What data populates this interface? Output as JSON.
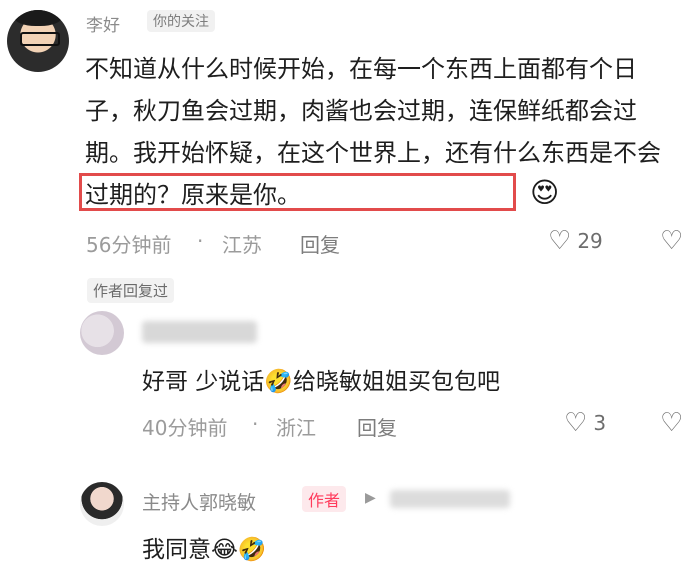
{
  "main_comment": {
    "username": "李好",
    "follow_label": "你的关注",
    "text": "不知道从什么时候开始，在每一个东西上面都有个日子，秋刀鱼会过期，肉酱也会过期，连保鲜纸都会过期。我开始怀疑，在这个世界上，还有什么东西是不会过期的？原来是你。",
    "emoji": "😍",
    "time": "56分钟前",
    "location": "江苏",
    "reply_label": "回复",
    "like_count": "29"
  },
  "author_replied_label": "作者回复过",
  "reply": {
    "text": "好哥 少说话🤣给晓敏姐姐买包包吧",
    "time": "40分钟前",
    "location": "浙江",
    "reply_label": "回复",
    "like_count": "3"
  },
  "host_reply": {
    "username": "主持人郭晓敏",
    "author_badge": "作者",
    "text": "我同意😂🤣"
  },
  "icons": {
    "like": "heart-outline-icon",
    "dislike": "broken-heart-icon",
    "arrow": "triangle-right-icon"
  },
  "colors": {
    "highlight": "#e24b4b",
    "author_badge": "#ff3b5c"
  }
}
